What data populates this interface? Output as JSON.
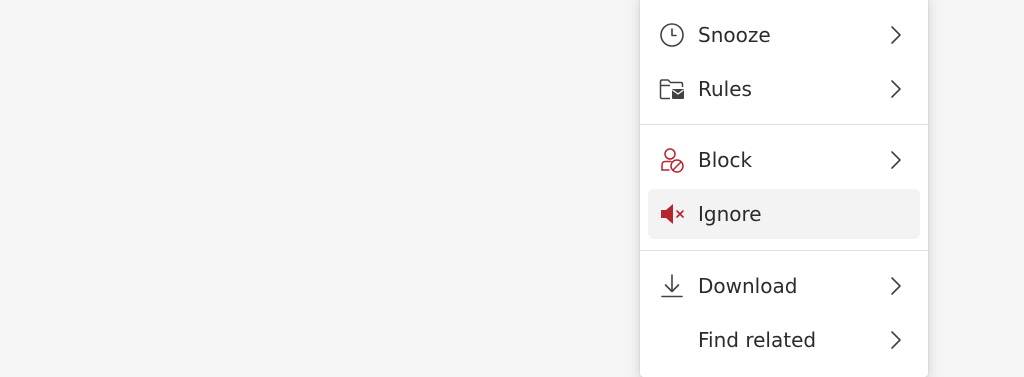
{
  "menu": {
    "items": [
      {
        "label": "Snooze",
        "icon": "clock-icon",
        "submenu": true
      },
      {
        "label": "Rules",
        "icon": "folder-rules-icon",
        "submenu": true
      },
      {
        "label": "Block",
        "icon": "block-person-icon",
        "submenu": true
      },
      {
        "label": "Ignore",
        "icon": "speaker-mute-icon",
        "submenu": false,
        "hovered": true
      },
      {
        "label": "Download",
        "icon": "download-icon",
        "submenu": true
      },
      {
        "label": "Find related",
        "icon": "",
        "submenu": true
      }
    ]
  },
  "colors": {
    "background": "#f5f5f5",
    "menu_background": "#ffffff",
    "hover_background": "#f3f3f3",
    "text": "#2b2b2b",
    "icon_gray": "#424242",
    "danger_red": "#b3262e"
  }
}
